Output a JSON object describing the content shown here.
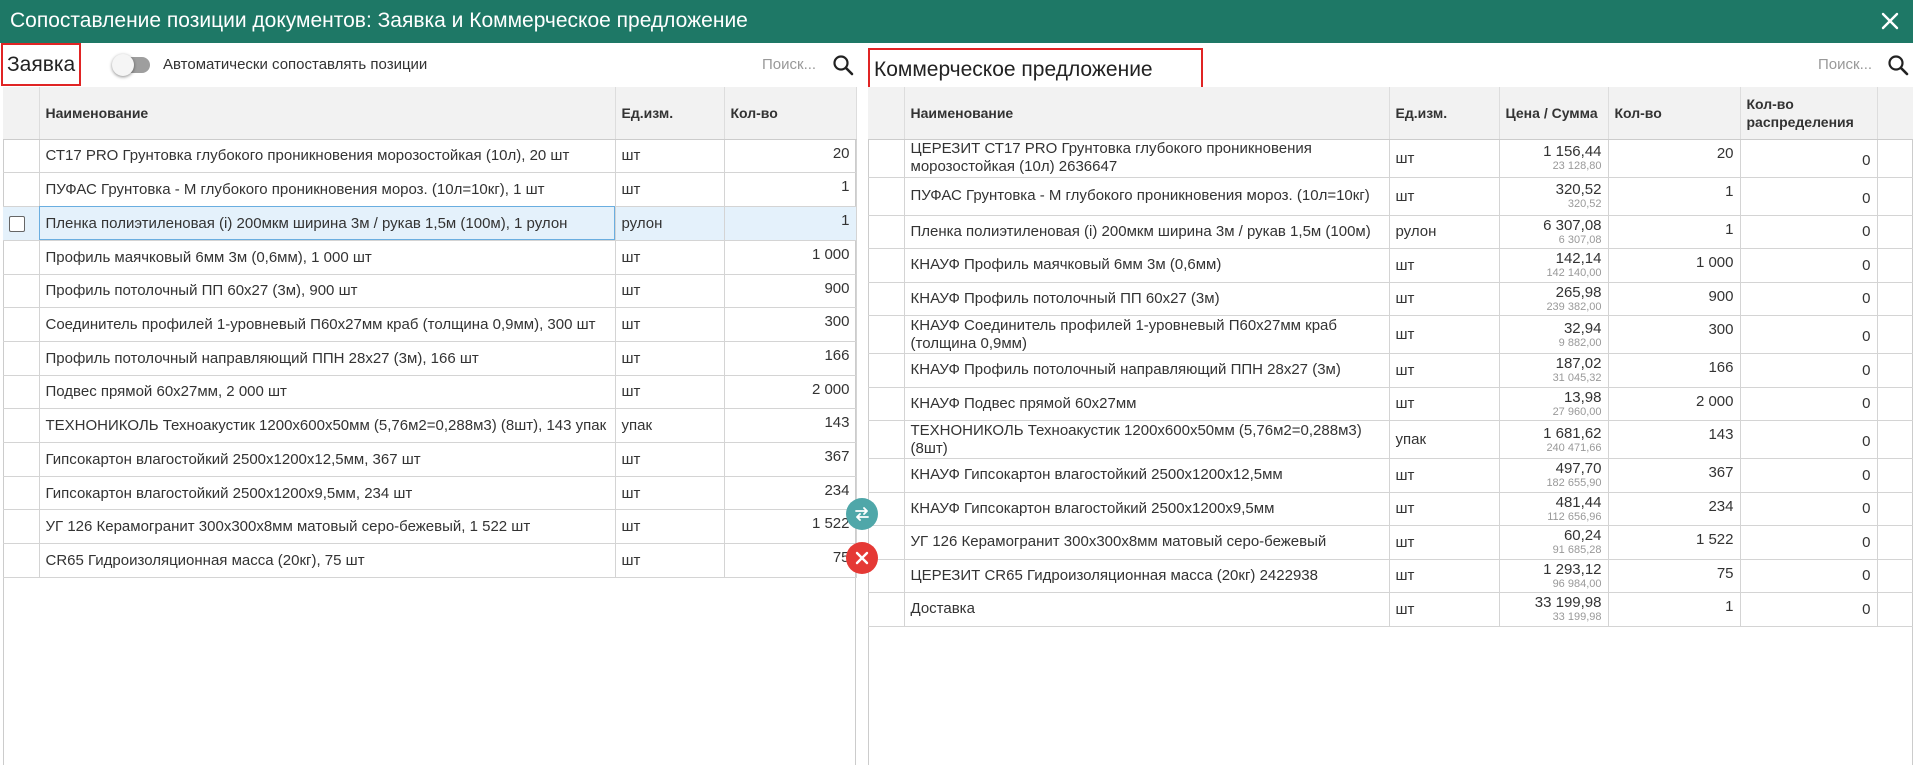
{
  "window": {
    "title": "Сопоставление позиции документов: Заявка и Коммерческое предложение"
  },
  "left": {
    "title": "Заявка",
    "toggle_label": "Автоматически сопоставлять позиции",
    "search_placeholder": "Поиск...",
    "columns": [
      "Наименование",
      "Ед.изм.",
      "Кол-во"
    ],
    "rows": [
      {
        "name": "СТ17 PRO Грунтовка глубокого проникновения морозостойкая (10л), 20 шт",
        "unit": "шт",
        "qty": "20"
      },
      {
        "name": "ПУФАС Грунтовка - М глубокого проникновения мороз. (10л=10кг), 1 шт",
        "unit": "шт",
        "qty": "1"
      },
      {
        "name": "Пленка полиэтиленовая (i) 200мкм ширина 3м / рукав 1,5м (100м), 1 рулон",
        "unit": "рулон",
        "qty": "1"
      },
      {
        "name": "Профиль маячковый 6мм 3м (0,6мм), 1 000 шт",
        "unit": "шт",
        "qty": "1 000"
      },
      {
        "name": "Профиль потолочный ПП 60х27 (3м), 900 шт",
        "unit": "шт",
        "qty": "900"
      },
      {
        "name": "Соединитель профилей 1-уровневый П60х27мм краб (толщина 0,9мм), 300 шт",
        "unit": "шт",
        "qty": "300"
      },
      {
        "name": "Профиль потолочный направляющий ППН 28х27 (3м), 166 шт",
        "unit": "шт",
        "qty": "166"
      },
      {
        "name": "Подвес прямой 60х27мм, 2 000 шт",
        "unit": "шт",
        "qty": "2 000"
      },
      {
        "name": "ТЕХНОНИКОЛЬ Техноакустик 1200х600х50мм (5,76м2=0,288м3) (8шт), 143 упак",
        "unit": "упак",
        "qty": "143"
      },
      {
        "name": "Гипсокартон влагостойкий 2500х1200х12,5мм, 367 шт",
        "unit": "шт",
        "qty": "367"
      },
      {
        "name": "Гипсокартон влагостойкий 2500х1200х9,5мм, 234 шт",
        "unit": "шт",
        "qty": "234"
      },
      {
        "name": "УГ 126 Керамогранит 300х300х8мм матовый серо-бежевый, 1 522 шт",
        "unit": "шт",
        "qty": "1 522"
      },
      {
        "name": "CR65 Гидроизоляционная масса (20кг), 75 шт",
        "unit": "шт",
        "qty": "75"
      }
    ]
  },
  "right": {
    "title": "Коммерческое предложение",
    "search_placeholder": "Поиск...",
    "columns": [
      "Наименование",
      "Ед.изм.",
      "Цена / Сумма",
      "Кол-во",
      "Кол-во распределения"
    ],
    "rows": [
      {
        "name": "ЦЕРЕЗИТ СТ17 PRO Грунтовка глубокого проникновения морозостойкая (10л) 2636647",
        "unit": "шт",
        "price": "1 156,44",
        "sum": "23 128,80",
        "qty": "20",
        "dist": "0"
      },
      {
        "name": "ПУФАС Грунтовка - М глубокого проникновения мороз. (10л=10кг)",
        "unit": "шт",
        "price": "320,52",
        "sum": "320,52",
        "qty": "1",
        "dist": "0"
      },
      {
        "name": "Пленка полиэтиленовая (i) 200мкм ширина 3м / рукав 1,5м (100м)",
        "unit": "рулон",
        "price": "6 307,08",
        "sum": "6 307,08",
        "qty": "1",
        "dist": "0"
      },
      {
        "name": "КНАУФ Профиль маячковый 6мм 3м (0,6мм)",
        "unit": "шт",
        "price": "142,14",
        "sum": "142 140,00",
        "qty": "1 000",
        "dist": "0"
      },
      {
        "name": "КНАУФ Профиль потолочный ПП 60х27 (3м)",
        "unit": "шт",
        "price": "265,98",
        "sum": "239 382,00",
        "qty": "900",
        "dist": "0"
      },
      {
        "name": "КНАУФ Соединитель профилей 1-уровневый П60х27мм краб (толщина 0,9мм)",
        "unit": "шт",
        "price": "32,94",
        "sum": "9 882,00",
        "qty": "300",
        "dist": "0"
      },
      {
        "name": "КНАУФ Профиль потолочный направляющий ППН 28х27 (3м)",
        "unit": "шт",
        "price": "187,02",
        "sum": "31 045,32",
        "qty": "166",
        "dist": "0"
      },
      {
        "name": "КНАУФ Подвес прямой 60х27мм",
        "unit": "шт",
        "price": "13,98",
        "sum": "27 960,00",
        "qty": "2 000",
        "dist": "0"
      },
      {
        "name": "ТЕХНОНИКОЛЬ Техноакустик 1200х600х50мм (5,76м2=0,288м3) (8шт)",
        "unit": "упак",
        "price": "1 681,62",
        "sum": "240 471,66",
        "qty": "143",
        "dist": "0"
      },
      {
        "name": "КНАУФ Гипсокартон влагостойкий 2500х1200х12,5мм",
        "unit": "шт",
        "price": "497,70",
        "sum": "182 655,90",
        "qty": "367",
        "dist": "0"
      },
      {
        "name": "КНАУФ Гипсокартон влагостойкий 2500х1200х9,5мм",
        "unit": "шт",
        "price": "481,44",
        "sum": "112 656,96",
        "qty": "234",
        "dist": "0"
      },
      {
        "name": "УГ 126 Керамогранит 300х300х8мм матовый серо-бежевый",
        "unit": "шт",
        "price": "60,24",
        "sum": "91 685,28",
        "qty": "1 522",
        "dist": "0"
      },
      {
        "name": "ЦЕРЕЗИТ CR65 Гидроизоляционная масса (20кг) 2422938",
        "unit": "шт",
        "price": "1 293,12",
        "sum": "96 984,00",
        "qty": "75",
        "dist": "0"
      },
      {
        "name": "Доставка",
        "unit": "шт",
        "price": "33 199,98",
        "sum": "33 199,98",
        "qty": "1",
        "dist": "0"
      }
    ]
  },
  "icons": {
    "close": "close-icon",
    "search": "search-icon",
    "swap": "swap-icon",
    "clear": "clear-icon"
  },
  "colors": {
    "titlebar": "#1e7866",
    "highlight_border": "#e02424",
    "swap_button": "#4fa7a9",
    "clear_button": "#e53935",
    "selected_row": "#e4f1fb"
  }
}
